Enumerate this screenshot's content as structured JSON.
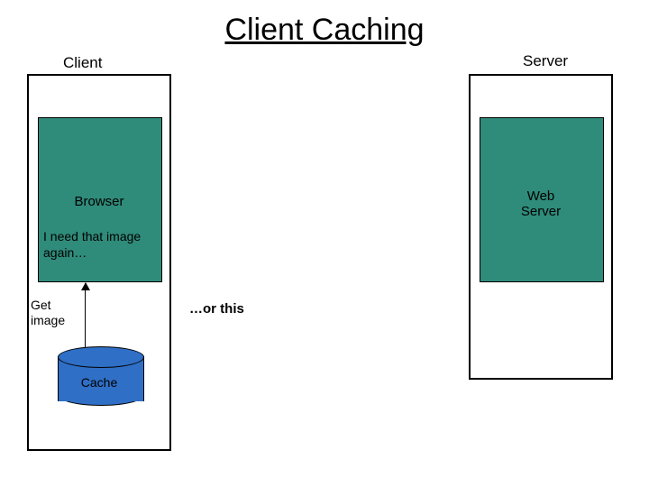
{
  "title": "Client Caching",
  "client_label": "Client",
  "server_label": "Server",
  "browser_label": "Browser",
  "web_server_label": "Web\nServer",
  "thought": "I need that image again…",
  "get_image": "Get image",
  "cache_label": "Cache",
  "or_this": "…or this",
  "chart_data": {
    "type": "diagram",
    "title": "Client Caching",
    "nodes": [
      {
        "id": "client",
        "label": "Client",
        "type": "container"
      },
      {
        "id": "server",
        "label": "Server",
        "type": "container"
      },
      {
        "id": "browser",
        "label": "Browser",
        "parent": "client",
        "type": "component",
        "note": "I need that image again…"
      },
      {
        "id": "web_server",
        "label": "Web Server",
        "parent": "server",
        "type": "component"
      },
      {
        "id": "cache",
        "label": "Cache",
        "parent": "client",
        "type": "datastore"
      }
    ],
    "edges": [
      {
        "from": "cache",
        "to": "browser",
        "label": "Get image"
      }
    ],
    "annotations": [
      "…or this"
    ]
  }
}
